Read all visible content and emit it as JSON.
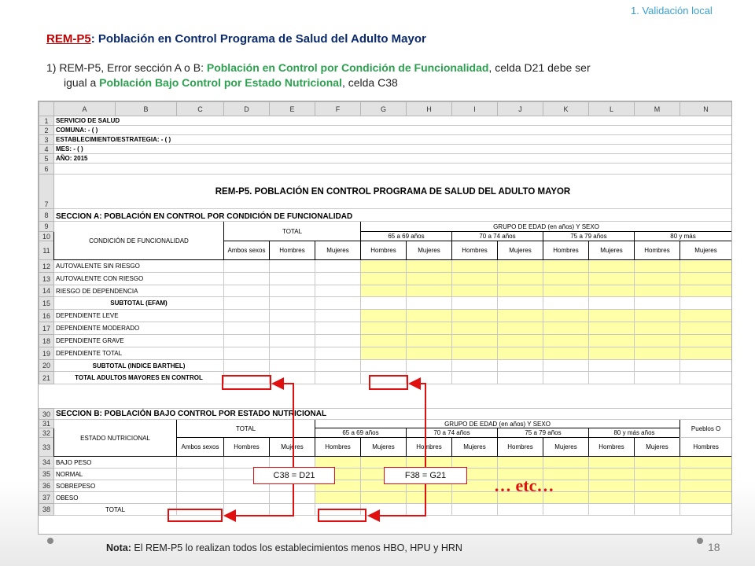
{
  "header": {
    "section": "1. Validación local"
  },
  "title": {
    "code": "REM-P5",
    "rest": ": Población en Control  Programa de Salud del Adulto Mayor"
  },
  "rule": {
    "num": "1)",
    "t1": "REM-P5, Error sección A o B: ",
    "h1": "Población en Control por Condición de Funcionalidad",
    "t2": ", celda D21 debe ser",
    "t3": "igual a ",
    "h2": "Población Bajo Control por Estado Nutricional",
    "t4": ", celda C38"
  },
  "sheet": {
    "cols": [
      "A",
      "B",
      "C",
      "D",
      "E",
      "F",
      "G",
      "H",
      "I",
      "J",
      "K",
      "L",
      "M",
      "N"
    ],
    "info": [
      "SERVICIO DE SALUD",
      "COMUNA:  - (  )",
      "ESTABLECIMIENTO/ESTRATEGIA:  - (  )",
      "MES:  - (  )",
      "AÑO: 2015"
    ],
    "main_title": "REM-P5.  POBLACIÓN EN CONTROL PROGRAMA DE SALUD DEL ADULTO MAYOR",
    "secA": {
      "title": "SECCION A:  POBLACIÓN EN CONTROL POR CONDICIÓN DE FUNCIONALIDAD",
      "cond_header": "CONDICIÓN DE FUNCIONALIDAD",
      "total": "TOTAL",
      "grupo": "GRUPO DE EDAD (en años) Y SEXO",
      "ages": [
        "65 a 69 años",
        "70 a 74 años",
        "75 a 79 años",
        "80 y más"
      ],
      "ambos": "Ambos sexos",
      "hombres": "Hombres",
      "mujeres": "Mujeres",
      "rows": [
        "AUTOVALENTE SIN RIESGO",
        "AUTOVALENTE CON RIESGO",
        "RIESGO DE DEPENDENCIA",
        "SUBTOTAL (EFAM)",
        "DEPENDIENTE LEVE",
        "DEPENDIENTE MODERADO",
        "DEPENDIENTE GRAVE",
        "DEPENDIENTE TOTAL",
        "SUBTOTAL (INDICE BARTHEL)",
        "TOTAL ADULTOS MAYORES EN CONTROL"
      ]
    },
    "secB": {
      "title": "SECCION B: POBLACIÓN BAJO CONTROL POR ESTADO NUTRICIONAL",
      "estado": "ESTADO NUTRICIONAL",
      "total": "TOTAL",
      "grupo": "GRUPO DE EDAD (en años) Y SEXO",
      "ages": [
        "65 a 69 años",
        "70 a 74 años",
        "75 a 79 años",
        "80 y más años"
      ],
      "pueblos": "Pueblos O",
      "ambos": "Ambos sexos",
      "hombres": "Hombres",
      "mujeres": "Mujeres",
      "rows": [
        "BAJO PESO",
        "NORMAL",
        "SOBREPESO",
        "OBESO",
        "TOTAL"
      ]
    }
  },
  "annotations": {
    "c38": "C38 = D21",
    "f38": "F38 = G21",
    "etc": "… etc…"
  },
  "note": {
    "label": "Nota:",
    "text": " El REM-P5 lo realizan todos los establecimientos menos HBO, HPU y HRN"
  },
  "page_number": "18"
}
